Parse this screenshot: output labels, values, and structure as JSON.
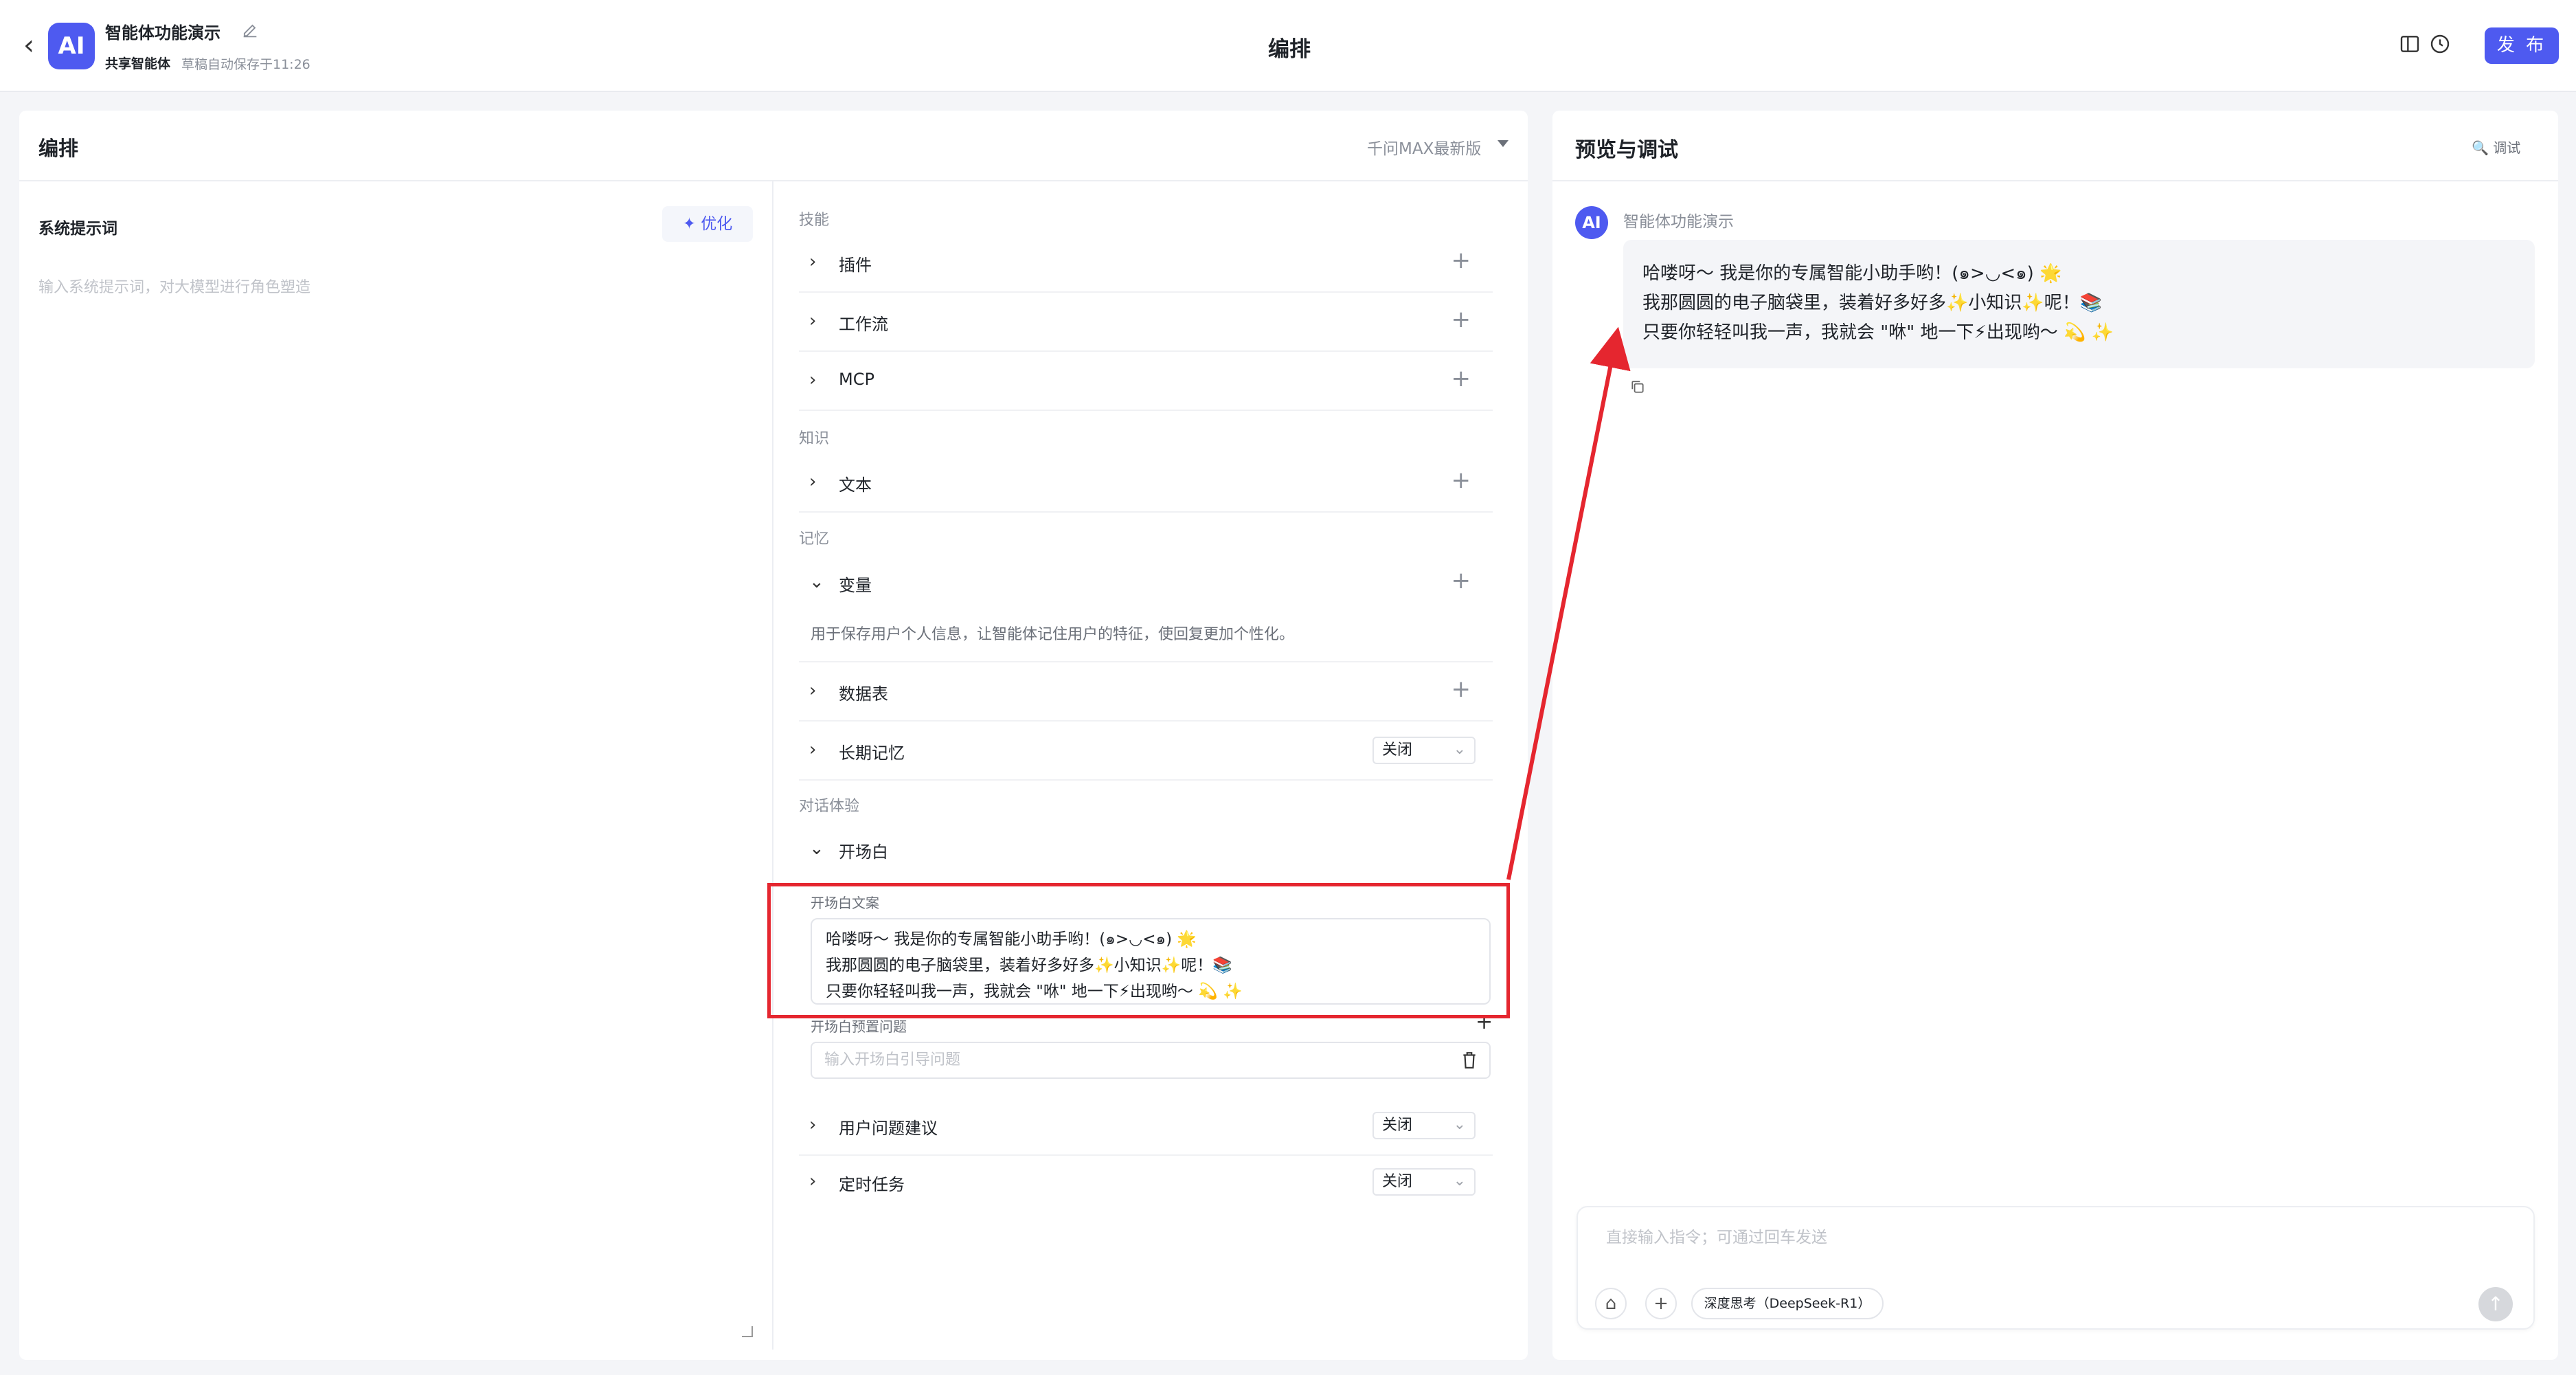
{
  "header": {
    "back_icon": "chevron-left-icon",
    "logo_text": "AI",
    "app_name": "智能体功能演示",
    "sub_type": "共享智能体",
    "save_status": "草稿自动保存于11:26",
    "page_title": "编排",
    "publish_label": "发 布",
    "accent_color": "#4e5af0"
  },
  "left": {
    "title": "编排",
    "model": "千问MAX最新版",
    "system_prompt": {
      "label": "系统提示词",
      "optimize_label": "优化",
      "placeholder": "输入系统提示词，对大模型进行角色塑造"
    },
    "sections": {
      "skills": "技能",
      "knowledge": "知识",
      "memory": "记忆",
      "dialog": "对话体验"
    },
    "rows": {
      "plugin": "插件",
      "workflow": "工作流",
      "mcp": "MCP",
      "text": "文本",
      "variable": "变量",
      "variable_desc": "用于保存用户个人信息，让智能体记住用户的特征，使回复更加个性化。",
      "datatable": "数据表",
      "long_memory": "长期记忆",
      "long_memory_value": "关闭",
      "opening": "开场白",
      "opening_label": "开场白文案",
      "opening_lines": [
        "哈喽呀～ 我是你的专属智能小助手哟！(๑>◡<๑) 🌟",
        "我那圆圆的电子脑袋里，装着好多好多✨小知识✨呢！📚",
        "只要你轻轻叫我一声，我就会 \"咻\" 地一下⚡出现哟～ 💫 ✨"
      ],
      "preset_label": "开场白预置问题",
      "preset_placeholder": "输入开场白引导问题",
      "suggest": "用户问题建议",
      "suggest_value": "关闭",
      "scheduled": "定时任务",
      "scheduled_value": "关闭"
    }
  },
  "right": {
    "title": "预览与调试",
    "debug_label": "调试",
    "bot_name": "智能体功能演示",
    "message_lines": [
      "哈喽呀～ 我是你的专属智能小助手哟！(๑>◡<๑) 🌟",
      "我那圆圆的电子脑袋里，装着好多好多✨小知识✨呢！📚",
      "只要你轻轻叫我一声，我就会 \"咻\" 地一下⚡出现哟～ 💫 ✨"
    ],
    "chat_placeholder": "直接输入指令；可通过回车发送",
    "deep_think_label": "深度思考（DeepSeek-R1）"
  },
  "annotation": {
    "color": "#e5262f"
  }
}
